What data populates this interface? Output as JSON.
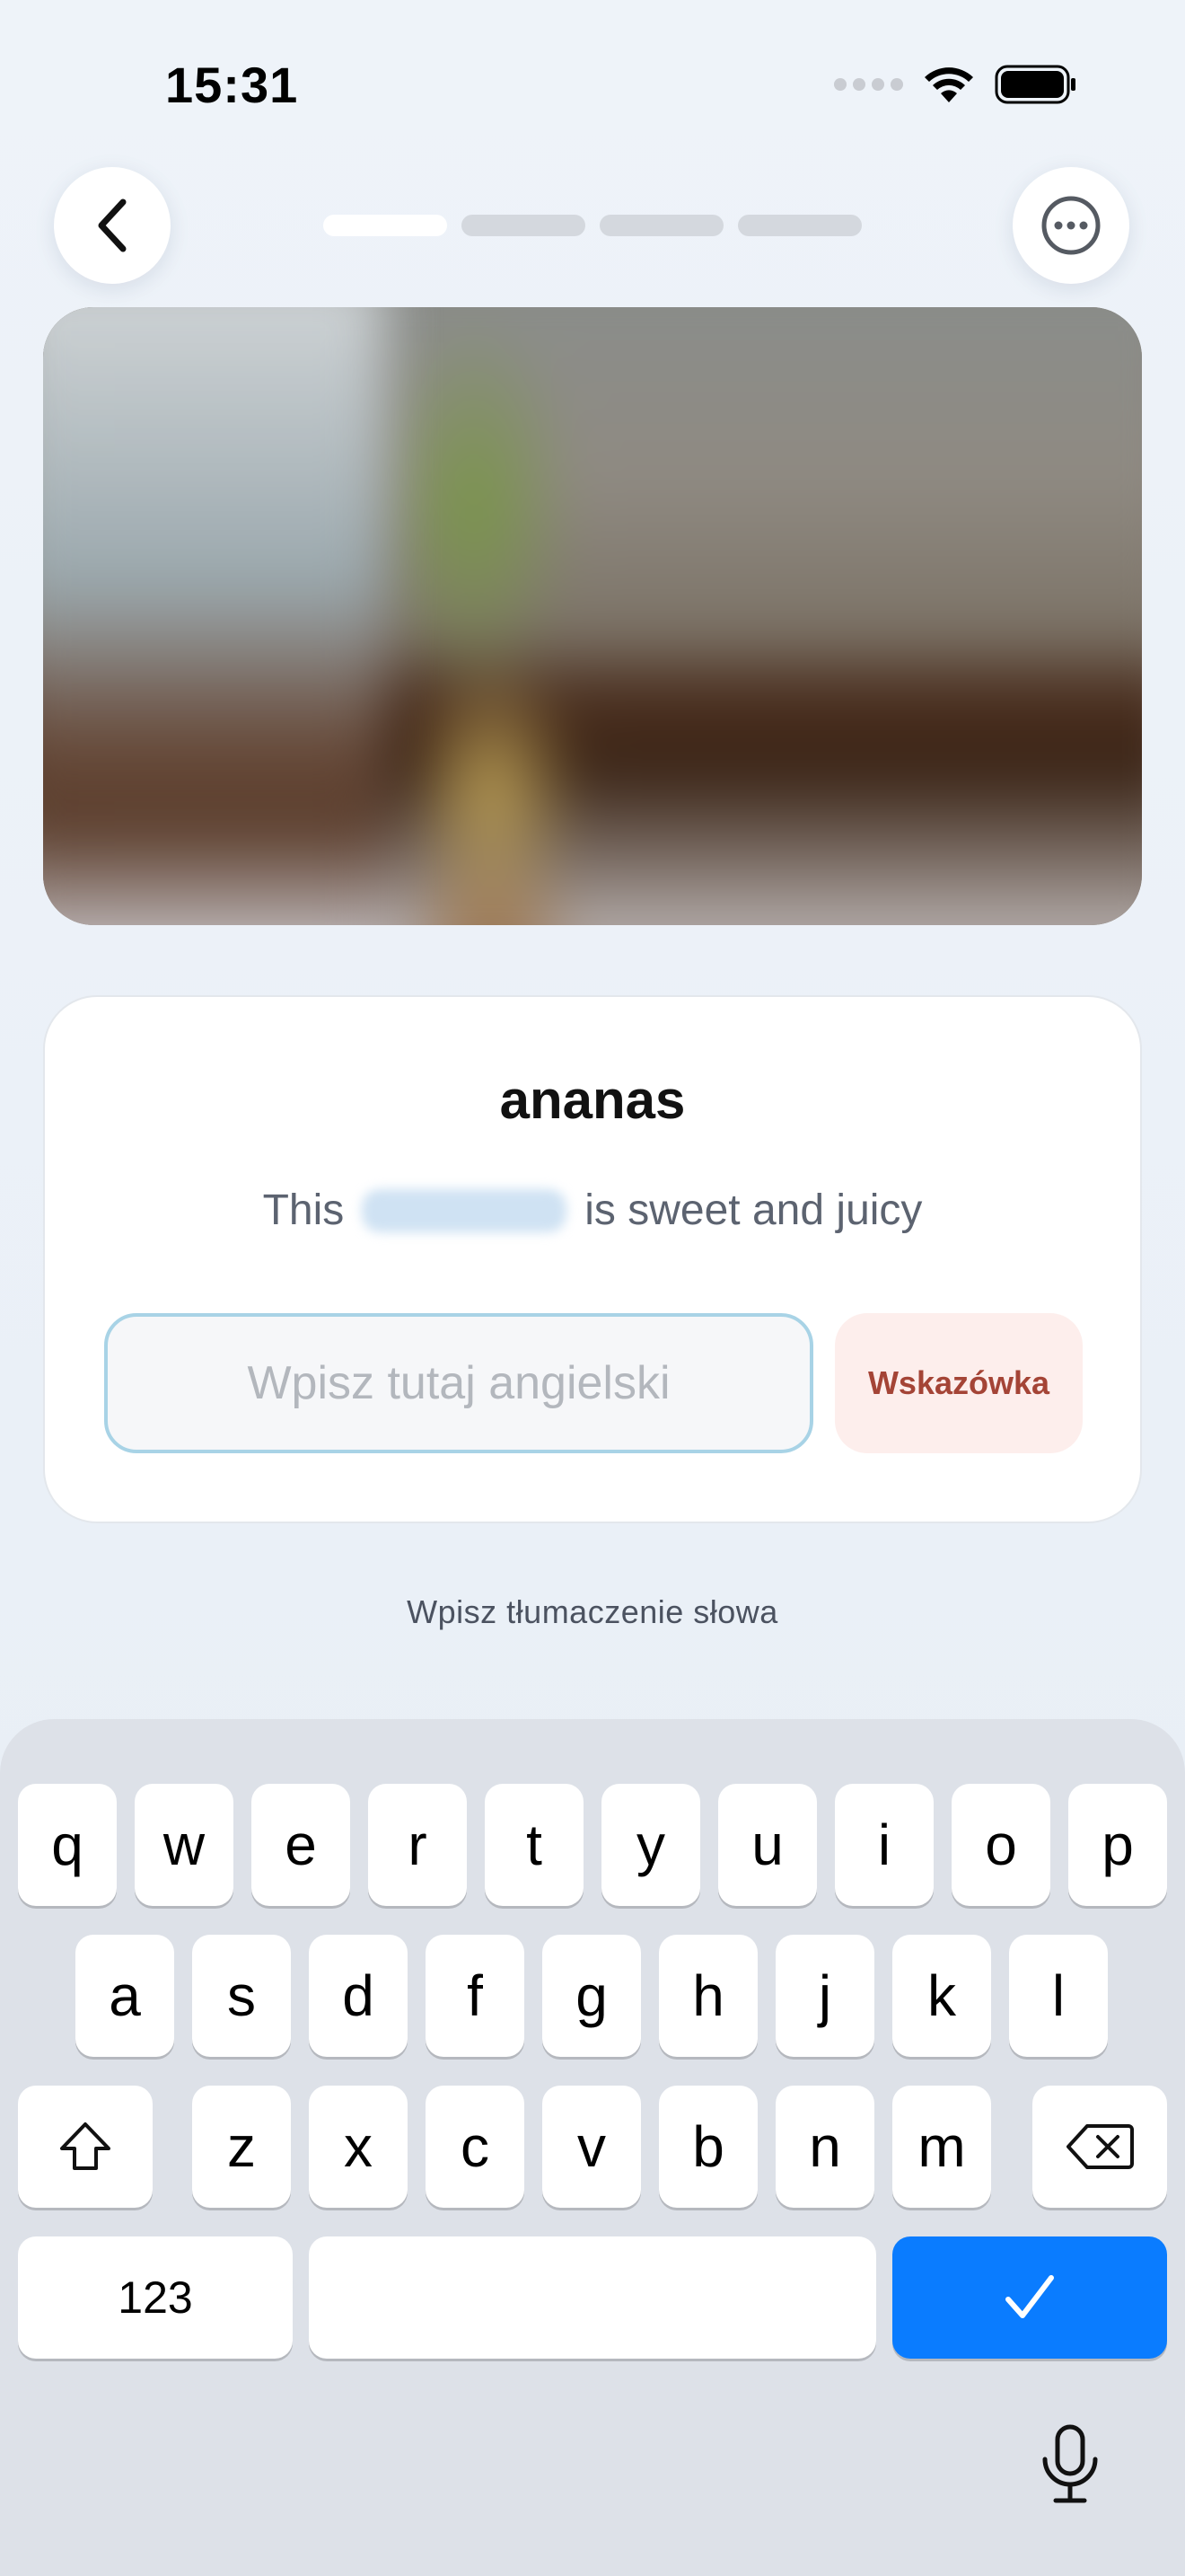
{
  "status_bar": {
    "time": "15:31"
  },
  "header": {
    "progress_total": 4,
    "progress_current": 1
  },
  "card": {
    "word": "ananas",
    "sentence_before": "This",
    "sentence_after": "is sweet and juicy",
    "input": {
      "value": "",
      "placeholder": "Wpisz tutaj angielski"
    },
    "hint_label": "Wskazówka"
  },
  "instruction": "Wpisz tłumaczenie słowa",
  "keyboard": {
    "row1": [
      "q",
      "w",
      "e",
      "r",
      "t",
      "y",
      "u",
      "i",
      "o",
      "p"
    ],
    "row2": [
      "a",
      "s",
      "d",
      "f",
      "g",
      "h",
      "j",
      "k",
      "l"
    ],
    "row3": [
      "z",
      "x",
      "c",
      "v",
      "b",
      "n",
      "m"
    ],
    "numbers_label": "123"
  },
  "colors": {
    "accent": "#0a7cff",
    "hint_bg": "#fdeeec",
    "hint_text": "#a44436",
    "input_border": "#a8d3e6"
  },
  "icons": [
    "back-chevron-icon",
    "more-icon",
    "wifi-icon",
    "battery-icon",
    "shift-icon",
    "delete-icon",
    "checkmark-icon",
    "microphone-icon"
  ]
}
